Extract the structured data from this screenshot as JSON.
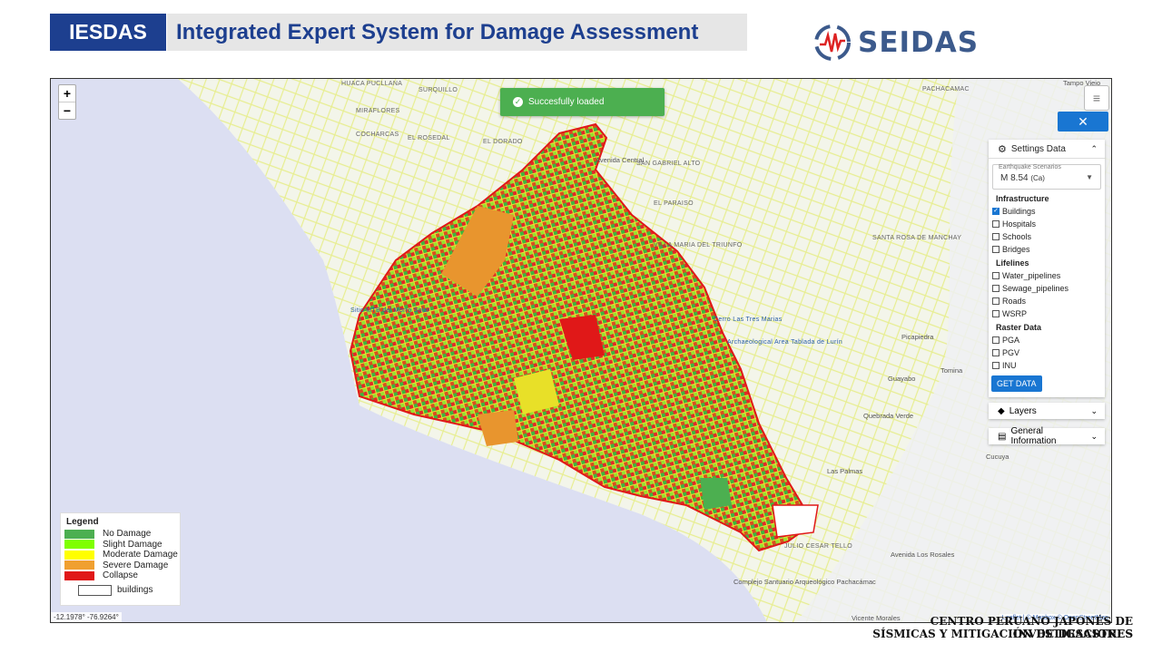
{
  "header": {
    "short_title": "IESDAS",
    "long_title": "Integrated Expert System for Damage Assessment",
    "logo_text": "SEIDAS"
  },
  "toast": {
    "message": "Succesfully loaded"
  },
  "map_labels": [
    "Huaca Pucllana",
    "SURQUILLO",
    "MIRAFLORES",
    "COCHARCAS",
    "EL ROSEDAL",
    "EL DORADO",
    "SAN GABRIEL ALTO",
    "EL PARAISO",
    "VILLA MARIA DEL TRIUNFO",
    "SANTA ROSA DE MANCHAY",
    "PACHACAMAC",
    "Picapiedra",
    "Guayabo",
    "Quebrada Verde",
    "Tomina",
    "Las Palmas",
    "JULIO CESAR TELLO",
    "Complejo Santuario Arqueológico Pachacámac",
    "Vicente Morales",
    "Cerro Las Tres Marias",
    "Archaeological Area Tablada de Lurín",
    "Sitio MTB del Morro Solar",
    "Avenida Central",
    "Avenida Los Rosales",
    "Cucuya",
    "Tampo Viejo"
  ],
  "panel": {
    "settings_title": "Settings Data",
    "scenario_label": "Earthquake Scenarios",
    "scenario_value": "M 8.54",
    "scenario_suffix": "(Ca)",
    "sections": {
      "infrastructure": "Infrastructure",
      "lifelines": "Lifelines",
      "raster": "Raster Data"
    },
    "infrastructure": [
      {
        "label": "Buildings",
        "checked": true
      },
      {
        "label": "Hospitals",
        "checked": false
      },
      {
        "label": "Schools",
        "checked": false
      },
      {
        "label": "Bridges",
        "checked": false
      }
    ],
    "lifelines": [
      {
        "label": "Water_pipelines",
        "checked": false
      },
      {
        "label": "Sewage_pipelines",
        "checked": false
      },
      {
        "label": "Roads",
        "checked": false
      },
      {
        "label": "WSRP",
        "checked": false
      }
    ],
    "raster": [
      {
        "label": "PGA",
        "checked": false
      },
      {
        "label": "PGV",
        "checked": false
      },
      {
        "label": "INU",
        "checked": false
      }
    ],
    "get_data": "GET DATA",
    "layers": "Layers",
    "general_info": "General Information"
  },
  "legend": {
    "title": "Legend",
    "items": [
      {
        "label": "No Damage",
        "color": "#4caf50"
      },
      {
        "label": "Slight Damage",
        "color": "#7fff00"
      },
      {
        "label": "Moderate Damage",
        "color": "#ffff00"
      },
      {
        "label": "Severe Damage",
        "color": "#f0a030"
      },
      {
        "label": "Collapse",
        "color": "#e01818"
      }
    ],
    "buildings_label": "buildings"
  },
  "map_status": {
    "coords": "-12.1978° -76.9264°",
    "attribution": "Leaflet | © Mapbox © OpenStreetMap"
  },
  "footer": {
    "line1": "CENTRO PERUANO JAPONÉS DE INVESTIGACIONES",
    "line2": "SÍSMICAS Y MITIGACIÓN DE DESASTRES"
  },
  "colors": {
    "brand_blue": "#1d3f8f",
    "accent": "#1976d2",
    "toast_green": "#4caf50",
    "boundary": "#e01818",
    "sea": "#dcdff2"
  }
}
